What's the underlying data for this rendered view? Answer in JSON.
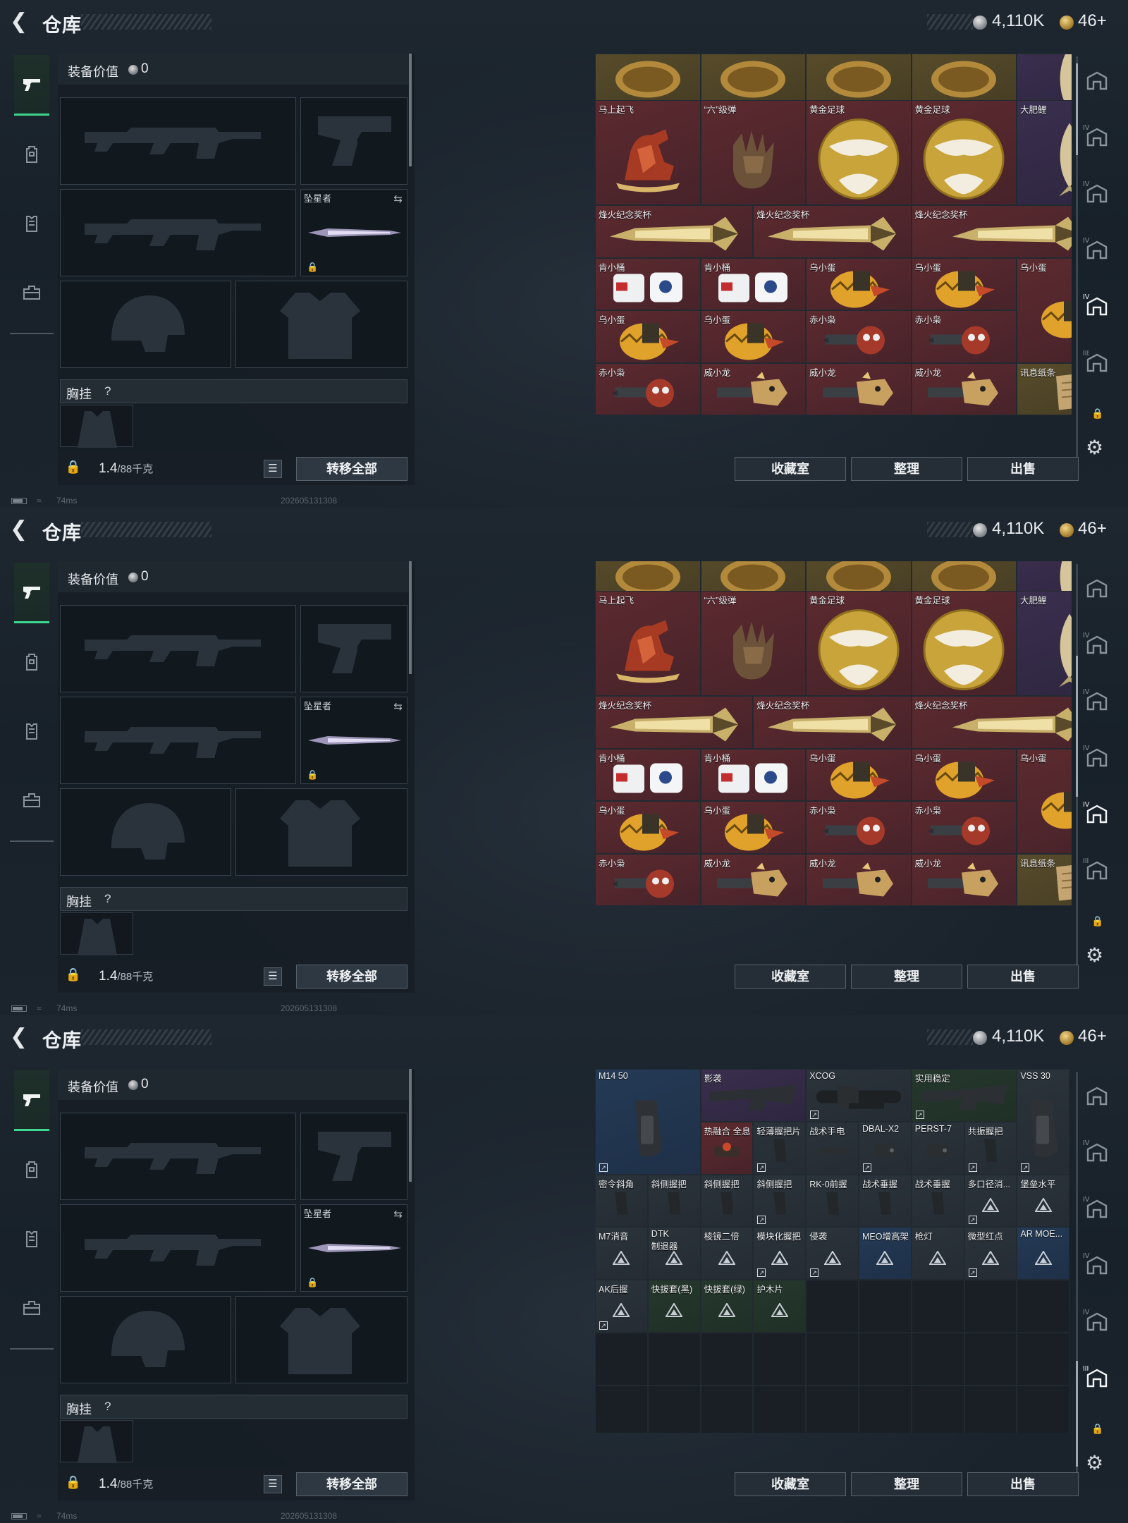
{
  "header": {
    "title": "仓库",
    "silver_amount": "4,110K",
    "gold_amount": "46+",
    "back_icon": "back-arrow-icon",
    "silver_icon": "silver-coin-icon",
    "gold_icon": "gold-coin-icon"
  },
  "tabs": [
    {
      "icon": "pistol-icon",
      "active": true
    },
    {
      "icon": "backpack-icon",
      "active": false
    },
    {
      "icon": "vest-icon",
      "active": false
    },
    {
      "icon": "case-icon",
      "active": false
    }
  ],
  "equipment": {
    "value_label": "装备价值",
    "value": "0",
    "melee_name": "坠星者",
    "chest_label": "胸挂",
    "help_glyph": "?",
    "weight": "1.4",
    "weight_unit": "/88千克",
    "transfer_all": "转移全部"
  },
  "status": {
    "ping": "74ms",
    "stamp": "202605131308"
  },
  "buttons": {
    "collection": "收藏室",
    "sort": "整理",
    "sell": "出售"
  },
  "storage_collectibles": [
    {
      "name": "",
      "rarity": "gold",
      "thumb": "coin",
      "col": 0,
      "row": -1,
      "w": 1,
      "h": 1
    },
    {
      "name": "",
      "rarity": "gold",
      "thumb": "coin",
      "col": 1,
      "row": -1,
      "w": 1,
      "h": 1
    },
    {
      "name": "",
      "rarity": "gold",
      "thumb": "coin",
      "col": 2,
      "row": -1,
      "w": 1,
      "h": 1
    },
    {
      "name": "",
      "rarity": "gold",
      "thumb": "coin",
      "col": 3,
      "row": -1,
      "w": 1,
      "h": 1
    },
    {
      "name": "",
      "rarity": "purple",
      "thumb": "fish",
      "col": 4,
      "row": -1,
      "w": 1,
      "h": 1
    },
    {
      "name": "马上起飞",
      "rarity": "red",
      "thumb": "horse",
      "col": 0,
      "row": 0,
      "w": 1,
      "h": 2
    },
    {
      "name": "“六”级弹",
      "rarity": "red",
      "thumb": "hand",
      "col": 1,
      "row": 0,
      "w": 1,
      "h": 2
    },
    {
      "name": "黄金足球",
      "rarity": "red",
      "thumb": "ball",
      "col": 2,
      "row": 0,
      "w": 1,
      "h": 2
    },
    {
      "name": "黄金足球",
      "rarity": "red",
      "thumb": "ball",
      "col": 3,
      "row": 0,
      "w": 1,
      "h": 2
    },
    {
      "name": "大肥鲤",
      "rarity": "purple",
      "thumb": "fish",
      "col": 4,
      "row": 0,
      "w": 1,
      "h": 2
    },
    {
      "name": "烽火纪念奖杯",
      "rarity": "red",
      "thumb": "trophy",
      "col": 0,
      "row": 2,
      "w": 1.5,
      "h": 1
    },
    {
      "name": "烽火纪念奖杯",
      "rarity": "red",
      "thumb": "trophy",
      "col": 1.5,
      "row": 2,
      "w": 1.5,
      "h": 1
    },
    {
      "name": "烽火纪念奖杯",
      "rarity": "red",
      "thumb": "trophy",
      "col": 3,
      "row": 2,
      "w": 2,
      "h": 1
    },
    {
      "name": "肯小桶",
      "rarity": "red",
      "thumb": "bucket",
      "col": 0,
      "row": 3,
      "w": 1,
      "h": 1
    },
    {
      "name": "肯小桶",
      "rarity": "red",
      "thumb": "bucket",
      "col": 1,
      "row": 3,
      "w": 1,
      "h": 1
    },
    {
      "name": "乌小蛋",
      "rarity": "red",
      "thumb": "egg",
      "col": 2,
      "row": 3,
      "w": 1,
      "h": 1
    },
    {
      "name": "乌小蛋",
      "rarity": "red",
      "thumb": "egg",
      "col": 3,
      "row": 3,
      "w": 1,
      "h": 1
    },
    {
      "name": "乌小蛋",
      "rarity": "red",
      "thumb": "egg",
      "col": 4,
      "row": 3,
      "w": 1,
      "h": 2
    },
    {
      "name": "乌小蛋",
      "rarity": "red",
      "thumb": "egg",
      "col": 0,
      "row": 4,
      "w": 1,
      "h": 1
    },
    {
      "name": "乌小蛋",
      "rarity": "red",
      "thumb": "egg",
      "col": 1,
      "row": 4,
      "w": 1,
      "h": 1
    },
    {
      "name": "赤小枭",
      "rarity": "red",
      "thumb": "owl",
      "col": 2,
      "row": 4,
      "w": 1,
      "h": 1
    },
    {
      "name": "赤小枭",
      "rarity": "red",
      "thumb": "owl",
      "col": 3,
      "row": 4,
      "w": 1,
      "h": 1
    },
    {
      "name": "赤小枭",
      "rarity": "red",
      "thumb": "owl",
      "col": 0,
      "row": 5,
      "w": 1,
      "h": 1
    },
    {
      "name": "威小龙",
      "rarity": "red",
      "thumb": "dragon",
      "col": 1,
      "row": 5,
      "w": 1,
      "h": 1
    },
    {
      "name": "威小龙",
      "rarity": "red",
      "thumb": "dragon",
      "col": 2,
      "row": 5,
      "w": 1,
      "h": 1
    },
    {
      "name": "威小龙",
      "rarity": "red",
      "thumb": "dragon",
      "col": 3,
      "row": 5,
      "w": 1,
      "h": 1
    },
    {
      "name": "讯息纸条",
      "rarity": "gold",
      "thumb": "paper",
      "col": 4,
      "row": 5,
      "w": 1,
      "h": 1
    }
  ],
  "storage_attachments": [
    {
      "name": "M14 50",
      "rarity": "blue",
      "thumb": "magazine",
      "col": 0,
      "row": 0,
      "w": 2,
      "h": 2,
      "corner": true
    },
    {
      "name": "影袭",
      "rarity": "purple",
      "thumb": "stock",
      "col": 2,
      "row": 0,
      "w": 2,
      "h": 1
    },
    {
      "name": "XCOG",
      "rarity": "gray",
      "thumb": "scope",
      "col": 4,
      "row": 0,
      "w": 2,
      "h": 1,
      "corner": true
    },
    {
      "name": "实用稳定",
      "rarity": "green",
      "thumb": "stock",
      "col": 6,
      "row": 0,
      "w": 2,
      "h": 1,
      "corner": true
    },
    {
      "name": "VSS 30",
      "rarity": "gray",
      "thumb": "magazine",
      "col": 8,
      "row": 0,
      "w": 1,
      "h": 2,
      "corner": true
    },
    {
      "name": "热融合 全息",
      "rarity": "red",
      "thumb": "sight",
      "col": 2,
      "row": 1,
      "w": 1,
      "h": 1
    },
    {
      "name": "轻薄握把片",
      "rarity": "gray",
      "thumb": "grip",
      "col": 3,
      "row": 1,
      "w": 1,
      "h": 1,
      "corner": true
    },
    {
      "name": "战术手电",
      "rarity": "gray",
      "thumb": "flashlight",
      "col": 4,
      "row": 1,
      "w": 1,
      "h": 1
    },
    {
      "name": "DBAL-X2",
      "rarity": "gray",
      "thumb": "laser",
      "col": 5,
      "row": 1,
      "w": 1,
      "h": 1,
      "corner": true
    },
    {
      "name": "PERST-7",
      "rarity": "gray",
      "thumb": "laser",
      "col": 6,
      "row": 1,
      "w": 1,
      "h": 1
    },
    {
      "name": "共振握把",
      "rarity": "gray",
      "thumb": "grip",
      "col": 7,
      "row": 1,
      "w": 1,
      "h": 1,
      "corner": true
    },
    {
      "name": "密令斜角",
      "rarity": "gray",
      "thumb": "grip",
      "col": 0,
      "row": 2,
      "w": 1,
      "h": 1
    },
    {
      "name": "斜侧握把",
      "rarity": "gray",
      "thumb": "grip",
      "col": 1,
      "row": 2,
      "w": 1,
      "h": 1
    },
    {
      "name": "斜侧握把",
      "rarity": "gray",
      "thumb": "grip",
      "col": 2,
      "row": 2,
      "w": 1,
      "h": 1
    },
    {
      "name": "斜侧握把",
      "rarity": "gray",
      "thumb": "grip",
      "col": 3,
      "row": 2,
      "w": 1,
      "h": 1,
      "corner": true
    },
    {
      "name": "RK-0前握",
      "rarity": "gray",
      "thumb": "grip",
      "col": 4,
      "row": 2,
      "w": 1,
      "h": 1
    },
    {
      "name": "战术垂握",
      "rarity": "gray",
      "thumb": "grip",
      "col": 5,
      "row": 2,
      "w": 1,
      "h": 1
    },
    {
      "name": "战术垂握",
      "rarity": "gray",
      "thumb": "grip",
      "col": 6,
      "row": 2,
      "w": 1,
      "h": 1
    },
    {
      "name": "多口径消...",
      "rarity": "gray",
      "thumb": "tier",
      "col": 7,
      "row": 2,
      "w": 1,
      "h": 1,
      "corner": true
    },
    {
      "name": "堡垒水平",
      "rarity": "gray",
      "thumb": "tier",
      "col": 8,
      "row": 2,
      "w": 1,
      "h": 1
    },
    {
      "name": "M7消音",
      "rarity": "gray",
      "thumb": "tier",
      "col": 0,
      "row": 3,
      "w": 1,
      "h": 1
    },
    {
      "name": "DTK\n制退器",
      "rarity": "gray",
      "thumb": "tier",
      "col": 1,
      "row": 3,
      "w": 1,
      "h": 1
    },
    {
      "name": "棱镜二倍",
      "rarity": "gray",
      "thumb": "tier",
      "col": 2,
      "row": 3,
      "w": 1,
      "h": 1
    },
    {
      "name": "模块化握把",
      "rarity": "gray",
      "thumb": "tier",
      "col": 3,
      "row": 3,
      "w": 1,
      "h": 1,
      "corner": true
    },
    {
      "name": "侵袭",
      "rarity": "gray",
      "thumb": "tier",
      "col": 4,
      "row": 3,
      "w": 1,
      "h": 1,
      "corner": true
    },
    {
      "name": "MEO增高架",
      "rarity": "blue",
      "thumb": "tier",
      "col": 5,
      "row": 3,
      "w": 1,
      "h": 1
    },
    {
      "name": "枪灯",
      "rarity": "gray",
      "thumb": "tier",
      "col": 6,
      "row": 3,
      "w": 1,
      "h": 1
    },
    {
      "name": "微型红点",
      "rarity": "gray",
      "thumb": "tier",
      "col": 7,
      "row": 3,
      "w": 1,
      "h": 1,
      "corner": true
    },
    {
      "name": "AR MOE...",
      "rarity": "blue",
      "thumb": "tier",
      "col": 8,
      "row": 3,
      "w": 1,
      "h": 1
    },
    {
      "name": "AK后握",
      "rarity": "gray",
      "thumb": "tier",
      "col": 0,
      "row": 4,
      "w": 1,
      "h": 1,
      "corner": true
    },
    {
      "name": "快拔套(黑)",
      "rarity": "green",
      "thumb": "tier",
      "col": 1,
      "row": 4,
      "w": 1,
      "h": 1
    },
    {
      "name": "快拔套(绿)",
      "rarity": "green",
      "thumb": "tier",
      "col": 2,
      "row": 4,
      "w": 1,
      "h": 1
    },
    {
      "name": "护木片",
      "rarity": "green",
      "thumb": "tier",
      "col": 3,
      "row": 4,
      "w": 1,
      "h": 1
    }
  ],
  "rail_icons": [
    {
      "icon": "storage-home-icon",
      "label": ""
    },
    {
      "icon": "storage-iv-add-icon",
      "label": "IV"
    },
    {
      "icon": "storage-iv-1-icon",
      "label": "IV"
    },
    {
      "icon": "storage-iv-2-icon",
      "label": "IV"
    },
    {
      "icon": "storage-iv-3-icon",
      "label": "IV"
    },
    {
      "icon": "storage-iii-icon",
      "label": "III"
    }
  ],
  "colors": {
    "accent_green": "#3dd68f",
    "rarity_red": "#5c2a2f",
    "rarity_gold": "#574b2a",
    "rarity_purple": "#3a2f4e",
    "rarity_blue": "#243a55"
  }
}
